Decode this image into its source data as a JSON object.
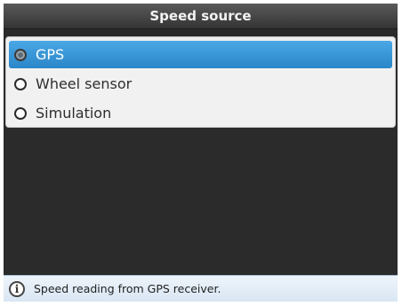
{
  "window": {
    "title": "Speed source"
  },
  "options": [
    {
      "label": "GPS",
      "selected": true
    },
    {
      "label": "Wheel sensor",
      "selected": false
    },
    {
      "label": "Simulation",
      "selected": false
    }
  ],
  "status": {
    "icon": "info-icon",
    "text": "Speed reading from GPS receiver."
  },
  "colors": {
    "selection": "#3597d8",
    "background": "#2b2b2b",
    "statusbar": "#dde8f4"
  }
}
